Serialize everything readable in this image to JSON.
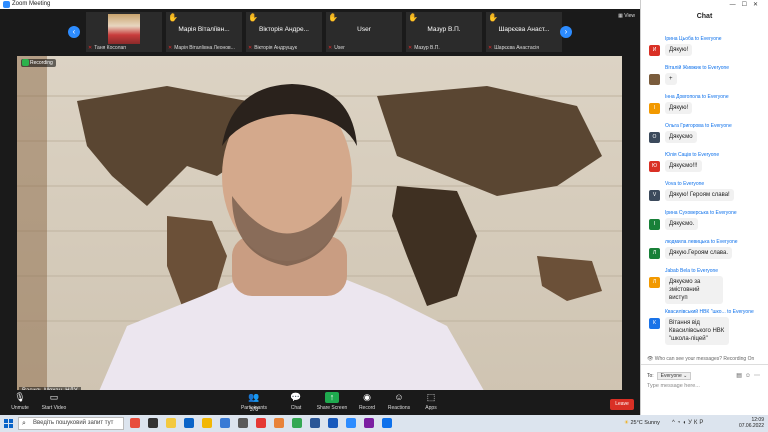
{
  "window": {
    "title": "Zoom Meeting"
  },
  "strip": {
    "view_label": "View",
    "tiles": [
      {
        "name": "",
        "sub": "Таня Косолап",
        "hand": false,
        "photo": true
      },
      {
        "name": "Марія Віталіївн...",
        "sub": "Марія Віталіївна Леонов...",
        "hand": true
      },
      {
        "name": "Вікторія Андре...",
        "sub": "Вікторія Андрущук",
        "hand": true
      },
      {
        "name": "User",
        "sub": "User",
        "hand": true
      },
      {
        "name": "Мазур В.П.",
        "sub": "Мазур В.П.",
        "hand": true
      },
      {
        "name": "Шарєєва Анаст...",
        "sub": "Шарєєва Анастасія",
        "hand": true
      }
    ]
  },
  "video": {
    "recording_label": "Recording",
    "speaker_name": "Василь Мохан, НДУ"
  },
  "toolbar": {
    "unmute": "Unmute",
    "start_video": "Start Video",
    "participants": "Participants",
    "participants_count": "373",
    "chat": "Chat",
    "share_screen": "Share Screen",
    "record": "Record",
    "reactions": "Reactions",
    "apps": "Apps",
    "leave": "Leave"
  },
  "chat": {
    "header": "Chat",
    "messages": [
      {
        "from": "Ірина Цьоба to Everyone",
        "text": "Дякую!",
        "initial": "И",
        "color": "#d93025"
      },
      {
        "from": "Віталій Живжик to Everyone",
        "text": "+",
        "initial": "",
        "color": "#7a5c3c"
      },
      {
        "from": "Інна Довгопола to Everyone",
        "text": "Дякую!",
        "initial": "І",
        "color": "#f29900"
      },
      {
        "from": "Ольга Григорова to Everyone",
        "text": "Дякуємо",
        "initial": "О",
        "color": "#3c4a5c"
      },
      {
        "from": "Юлія Саців to Everyone",
        "text": "Дякуємо!!!",
        "initial": "Ю",
        "color": "#d93025"
      },
      {
        "from": "Vova to Everyone",
        "text": "Дякую! Героям слава!",
        "initial": "V",
        "color": "#3c4a5c"
      },
      {
        "from": "Ірина Суховерська to Everyone",
        "text": "Дякуємо.",
        "initial": "І",
        "color": "#188038"
      },
      {
        "from": "людмила левицька to Everyone",
        "text": "Дякую.Героям слава.",
        "initial": "Л",
        "color": "#188038"
      },
      {
        "from": "Jabab Bela to Everyone",
        "text": "Дякуємо за змістовний виступ",
        "initial": "Л",
        "color": "#f29900"
      },
      {
        "from": "Квасилівський НВК \"шко... to Everyone",
        "text": "Вітання від Квасилівського НВК \"школа-ліцей\"",
        "initial": "К",
        "color": "#1a73e8"
      }
    ],
    "who_can_see": "Who can see your messages? Recording On",
    "to_label": "To:",
    "to_value": "Everyone",
    "input_placeholder": "Type message here..."
  },
  "taskbar": {
    "search_placeholder": "Введіть пошуковий запит тут",
    "weather": "25°C  Sunny",
    "time": "12:09",
    "date": "07.06.2022",
    "lang": "УКР"
  }
}
